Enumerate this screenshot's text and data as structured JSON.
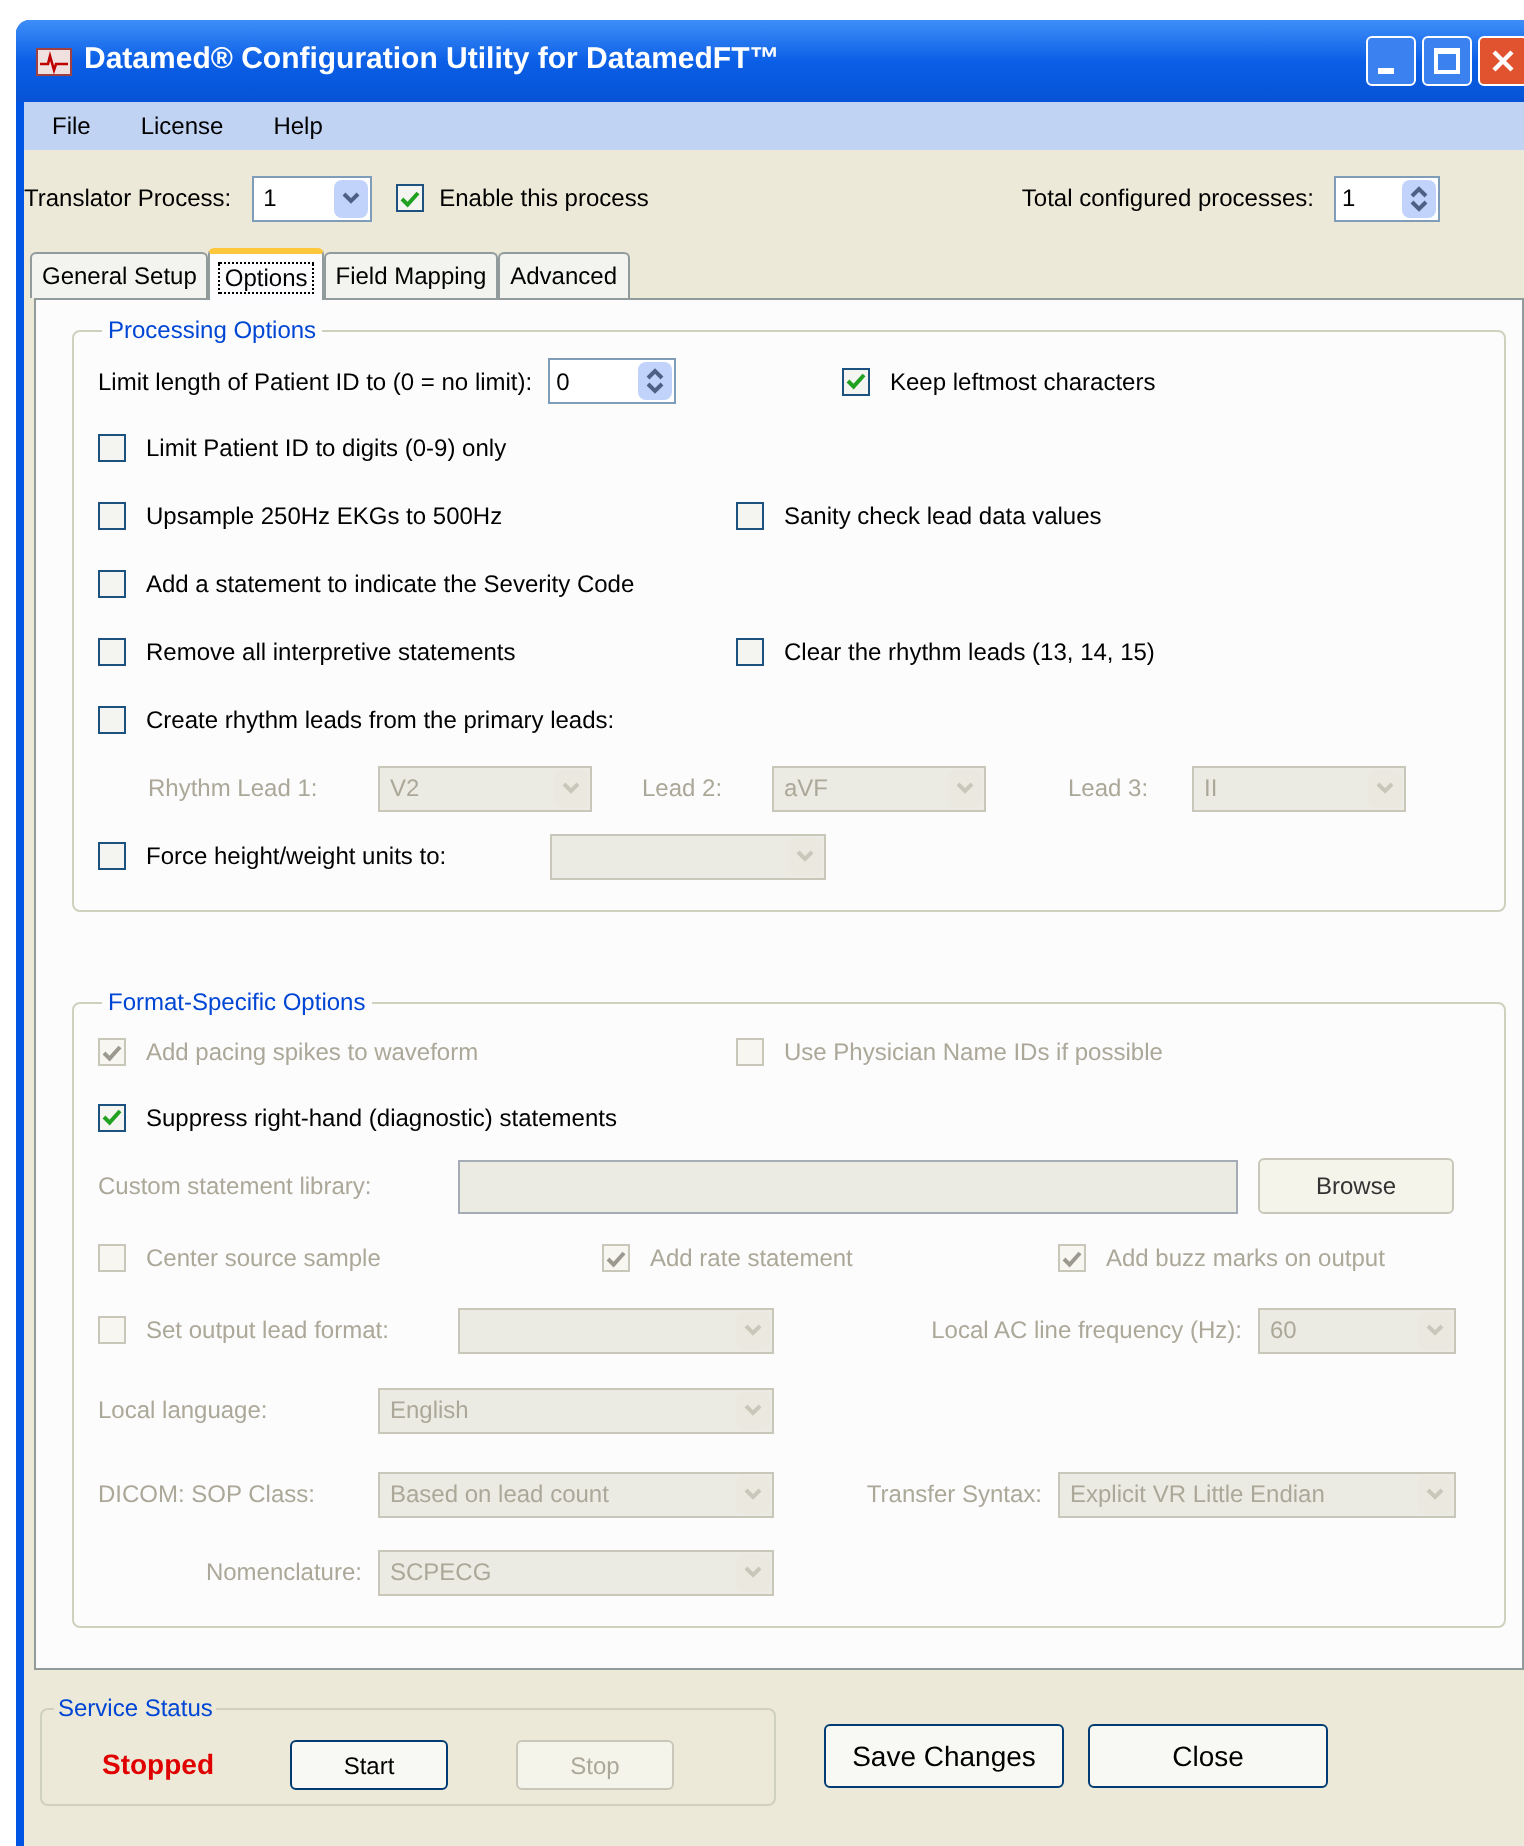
{
  "window": {
    "title": "Datamed® Configuration Utility for DatamedFT™"
  },
  "menu": [
    "File",
    "License",
    "Help"
  ],
  "process_bar": {
    "translator_label": "Translator Process:",
    "translator_value": "1",
    "enable": {
      "label": "Enable this process",
      "checked": true
    },
    "total_label": "Total configured processes:",
    "total_value": "1"
  },
  "tabs": [
    {
      "label": "General Setup",
      "selected": false
    },
    {
      "label": "Options",
      "selected": true
    },
    {
      "label": "Field Mapping",
      "selected": false
    },
    {
      "label": "Advanced",
      "selected": false
    }
  ],
  "processing_options": {
    "title": "Processing Options",
    "rows": [
      [
        {
          "kind": "spin",
          "label": "Limit length of Patient ID to (0 = no limit):",
          "value": "0"
        },
        {
          "kind": "checkbox",
          "label": "Keep leftmost characters",
          "checked": true,
          "disabled": false
        }
      ],
      [
        {
          "kind": "checkbox",
          "label": "Limit Patient ID to digits (0-9) only",
          "checked": false,
          "disabled": false
        }
      ],
      [
        {
          "kind": "checkbox",
          "label": "Upsample 250Hz EKGs to 500Hz",
          "checked": false,
          "disabled": false
        },
        {
          "kind": "checkbox",
          "label": "Sanity check lead data values",
          "checked": false,
          "disabled": false
        }
      ],
      [
        {
          "kind": "checkbox",
          "label": "Add a statement to indicate the Severity Code",
          "checked": false,
          "disabled": false
        }
      ],
      [
        {
          "kind": "checkbox",
          "label": "Remove all interpretive statements",
          "checked": false,
          "disabled": false
        },
        {
          "kind": "checkbox",
          "label": "Clear the rhythm leads (13, 14, 15)",
          "checked": false,
          "disabled": false
        }
      ],
      [
        {
          "kind": "checkbox",
          "label": "Create rhythm leads from the primary leads:",
          "checked": false,
          "disabled": false
        }
      ],
      [
        {
          "kind": "select",
          "label": "Rhythm Lead 1:",
          "value": "V2",
          "disabled": true
        },
        {
          "kind": "select",
          "label": "Lead 2:",
          "value": "aVF",
          "disabled": true
        },
        {
          "kind": "select",
          "label": "Lead 3:",
          "value": "II",
          "disabled": true
        }
      ],
      [
        {
          "kind": "select_check",
          "label": "Force height/weight units to:",
          "checked": false,
          "disabled": false,
          "select_disabled": true
        }
      ]
    ]
  },
  "format_options": {
    "title": "Format-Specific Options",
    "rows": [
      [
        {
          "kind": "checkbox",
          "label": "Add pacing spikes to waveform",
          "checked": true,
          "disabled": true
        },
        {
          "kind": "checkbox",
          "label": "Use Physician Name IDs if possible",
          "checked": false,
          "disabled": true
        }
      ],
      [
        {
          "kind": "checkbox",
          "label": "Suppress right-hand (diagnostic) statements",
          "checked": true,
          "disabled": false
        }
      ],
      [
        {
          "kind": "text",
          "label": "Custom statement library:",
          "disabled": true,
          "button": "Browse"
        }
      ],
      [
        {
          "kind": "checkbox",
          "label": "Center source sample",
          "checked": false,
          "disabled": true
        },
        {
          "kind": "checkbox",
          "label": "Add rate statement",
          "checked": true,
          "disabled": true
        },
        {
          "kind": "checkbox",
          "label": "Add buzz marks on output",
          "checked": true,
          "disabled": true
        }
      ],
      [
        {
          "kind": "select_check",
          "label": "Set output lead format:",
          "checked": false,
          "disabled": true,
          "select_disabled": true
        },
        {
          "kind": "select",
          "label": "Local AC line frequency (Hz):",
          "value": "60",
          "disabled": true
        }
      ],
      [
        {
          "kind": "select",
          "label": "Local language:",
          "value": "English",
          "disabled": true
        }
      ],
      [
        {
          "kind": "select",
          "label": "DICOM: SOP Class:",
          "value": "Based on lead count",
          "disabled": true
        },
        {
          "kind": "select",
          "label": "Transfer Syntax:",
          "value": "Explicit VR Little Endian",
          "disabled": true
        }
      ],
      [
        {
          "kind": "select",
          "label": "Nomenclature:",
          "value": "SCPECG",
          "disabled": true
        }
      ]
    ]
  },
  "service_status": {
    "title": "Service Status",
    "status": "Stopped",
    "buttons": [
      {
        "label": "Start",
        "disabled": false
      },
      {
        "label": "Stop",
        "disabled": true
      }
    ]
  },
  "actions": [
    {
      "label": "Save Changes"
    },
    {
      "label": "Close"
    }
  ]
}
